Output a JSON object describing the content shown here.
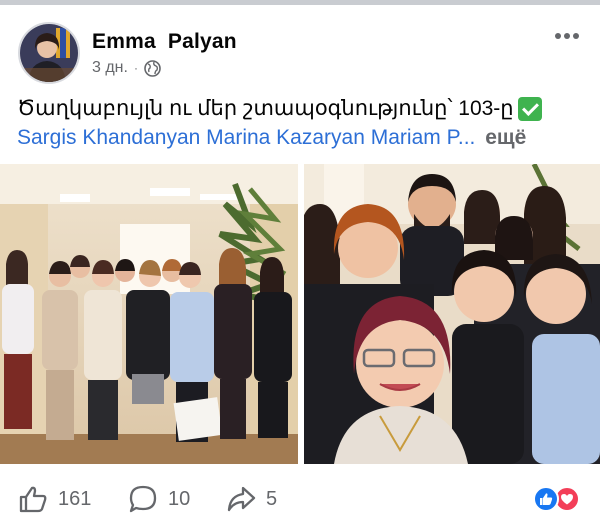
{
  "post": {
    "author": "Emma  Palyan",
    "time": "3 дн.",
    "separator": "·",
    "caption": "Ծաղկաբույլն ու մեր շտապօգնությունը՝ 103-ը",
    "tags": [
      "Sargis Khandanyan",
      "Marina Kazaryan",
      "Mariam P"
    ],
    "tags_ellipsis": "...",
    "see_more": "ещё"
  },
  "stats": {
    "likes": "161",
    "comments": "10",
    "shares": "5"
  },
  "icons": {
    "avatar": "profile-photo",
    "visibility": "globe-icon",
    "menu": "more-dots-icon",
    "caption_emoji": "check-mark-button-icon",
    "like": "thumbs-up-icon",
    "comment": "comment-bubble-icon",
    "share": "share-arrow-icon",
    "reactions": [
      "like-reaction-icon",
      "love-reaction-icon"
    ]
  },
  "colors": {
    "link": "#2d6fd6",
    "secondary_text": "#65676b",
    "like_blue": "#1877f2",
    "love_red": "#f33e58",
    "check_green": "#3fb34f"
  }
}
